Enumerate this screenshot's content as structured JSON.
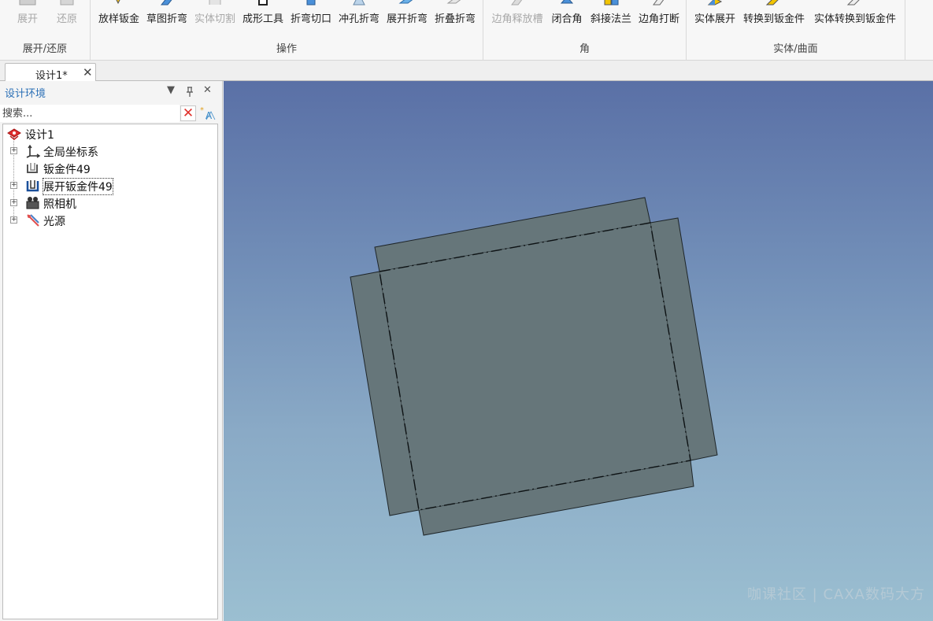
{
  "ribbon": {
    "groups": [
      {
        "label": "展开/还原",
        "buttons": [
          {
            "label": "展开",
            "disabled": true
          },
          {
            "label": "还原",
            "disabled": true
          }
        ]
      },
      {
        "label": "操作",
        "buttons": [
          {
            "label": "放样钣金",
            "disabled": false
          },
          {
            "label": "草图折弯",
            "disabled": false
          },
          {
            "label": "实体切割",
            "disabled": true
          },
          {
            "label": "成形工具",
            "disabled": false
          },
          {
            "label": "折弯切口",
            "disabled": false
          },
          {
            "label": "冲孔折弯",
            "disabled": false
          },
          {
            "label": "展开折弯",
            "disabled": false
          },
          {
            "label": "折叠折弯",
            "disabled": false
          }
        ]
      },
      {
        "label": "角",
        "buttons": [
          {
            "label": "边角释放槽",
            "disabled": true
          },
          {
            "label": "闭合角",
            "disabled": false
          },
          {
            "label": "斜接法兰",
            "disabled": false
          },
          {
            "label": "边角打断",
            "disabled": false
          }
        ]
      },
      {
        "label": "实体/曲面",
        "buttons": [
          {
            "label": "实体展开",
            "disabled": false
          },
          {
            "label": "转换到钣金件",
            "disabled": false
          },
          {
            "label": "实体转换到钣金件",
            "disabled": false
          }
        ]
      }
    ]
  },
  "tabs": [
    {
      "label": "设计1*",
      "close": "✕"
    }
  ],
  "panel": {
    "title": "设计环境",
    "search": {
      "placeholder": "搜索..."
    },
    "tree": [
      {
        "label": "设计1",
        "icon": "design-icon",
        "level": 0,
        "expandable": false
      },
      {
        "label": "全局坐标系",
        "icon": "axis-icon",
        "level": 1,
        "expandable": true
      },
      {
        "label": "钣金件49",
        "icon": "sheetmetal-icon",
        "level": 1,
        "expandable": false
      },
      {
        "label": "展开钣金件49",
        "icon": "sheetmetal-unfold-icon",
        "level": 1,
        "expandable": true,
        "selected": true
      },
      {
        "label": "照相机",
        "icon": "camera-icon",
        "level": 1,
        "expandable": true
      },
      {
        "label": "光源",
        "icon": "light-icon",
        "level": 1,
        "expandable": true
      }
    ]
  },
  "viewport": {
    "watermark": "咖课社区 | CAXA数码大方"
  },
  "colors": {
    "accent": "#2a6fb6",
    "part_fill": "#66767a",
    "viewport_top": "#5a70a6",
    "viewport_bottom": "#9bbfd1"
  }
}
